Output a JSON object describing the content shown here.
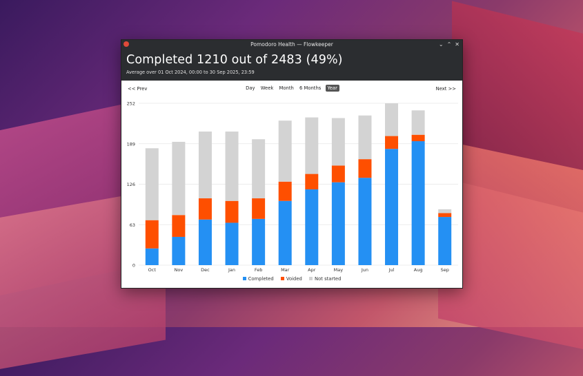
{
  "window": {
    "title": "Pomodoro Health — Flowkeeper",
    "controls": [
      "chevron-down",
      "chevron-up",
      "close"
    ]
  },
  "header": {
    "title": "Completed 1210 out of 2483 (49%)",
    "subtitle": "Average over 01 Oct 2024, 00:00 to 30 Sep 2025, 23:59"
  },
  "nav": {
    "prev": "<< Prev",
    "next": "Next >>",
    "periods": [
      "Day",
      "Week",
      "Month",
      "6 Months",
      "Year"
    ],
    "active_period": "Year"
  },
  "colors": {
    "completed": "#2490f3",
    "voided": "#fe4f00",
    "not_started": "#d3d3d3",
    "grid": "#e6e6e6"
  },
  "chart_data": {
    "type": "bar",
    "stacked": true,
    "categories": [
      "Oct",
      "Nov",
      "Dec",
      "Jan",
      "Feb",
      "Mar",
      "Apr",
      "May",
      "Jun",
      "Jul",
      "Aug",
      "Sep"
    ],
    "series": [
      {
        "name": "Completed",
        "values": [
          26,
          44,
          71,
          66,
          72,
          100,
          118,
          129,
          136,
          181,
          193,
          75
        ]
      },
      {
        "name": "Voided",
        "values": [
          44,
          34,
          33,
          34,
          32,
          30,
          24,
          26,
          29,
          20,
          10,
          6
        ]
      },
      {
        "name": "Not started",
        "values": [
          112,
          114,
          104,
          108,
          92,
          95,
          88,
          74,
          68,
          51,
          38,
          6
        ]
      }
    ],
    "yticks": [
      0,
      63,
      126,
      189,
      252
    ],
    "ylim": [
      0,
      252
    ],
    "grid": true,
    "legend": "bottom-center"
  }
}
